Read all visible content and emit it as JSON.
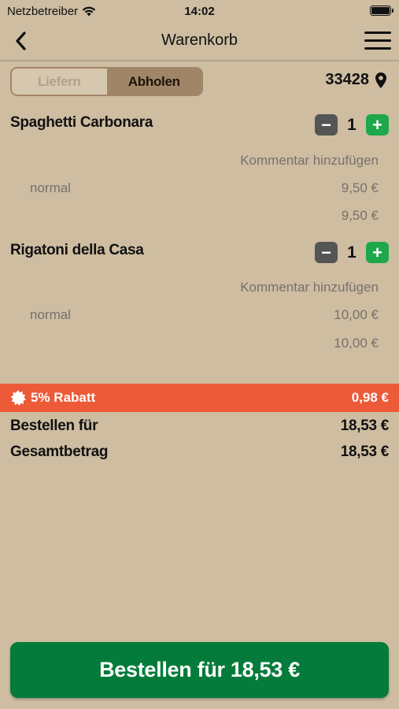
{
  "status_bar": {
    "carrier": "Netzbetreiber",
    "time": "14:02"
  },
  "nav": {
    "title": "Warenkorb"
  },
  "segment": {
    "delivery_label": "Liefern",
    "pickup_label": "Abholen",
    "selected": "Abholen"
  },
  "location": {
    "postal_code": "33428"
  },
  "cart_items": [
    {
      "name": "Spaghetti Carbonara",
      "quantity": "1",
      "comment_label": "Kommentar hinzufügen",
      "variant": "normal",
      "variant_price": "9,50 €",
      "line_total": "9,50 €"
    },
    {
      "name": "Rigatoni della Casa",
      "quantity": "1",
      "comment_label": "Kommentar hinzufügen",
      "variant": "normal",
      "variant_price": "10,00 €",
      "line_total": "10,00 €"
    }
  ],
  "discount": {
    "label": "5% Rabatt",
    "amount": "0,98 €"
  },
  "totals": {
    "order_label": "Bestellen für",
    "order_amount": "18,53 €",
    "grand_label": "Gesamtbetrag",
    "grand_amount": "18,53 €"
  },
  "order_button": {
    "label": "Bestellen für 18,53 €"
  },
  "colors": {
    "background": "#cebda1",
    "accent_brown": "#a08566",
    "discount": "#ed5a38",
    "order_green": "#047b3a",
    "plus_green": "#1fa84a"
  }
}
